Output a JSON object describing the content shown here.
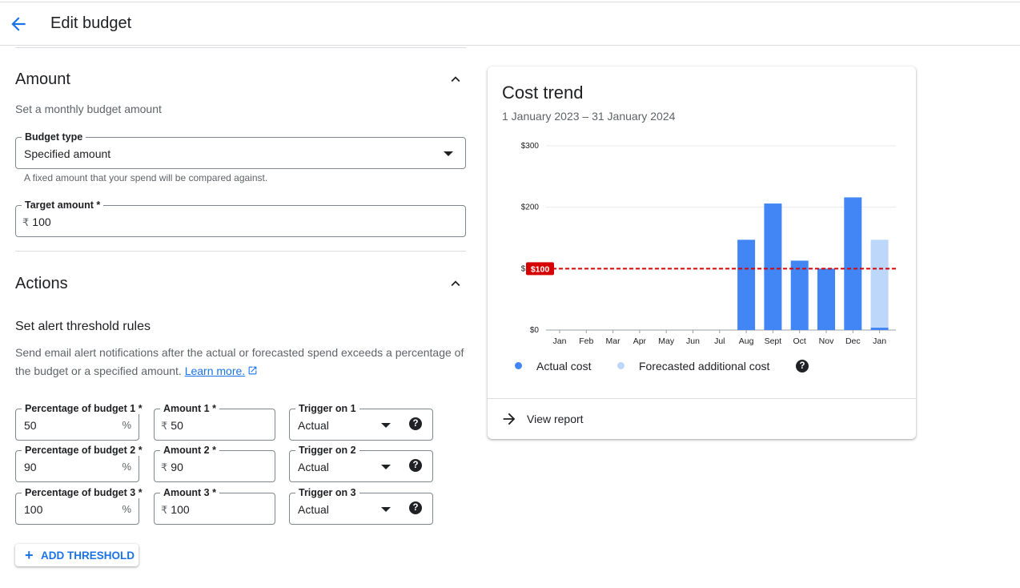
{
  "header": {
    "title": "Edit budget"
  },
  "amount": {
    "title": "Amount",
    "subtitle": "Set a monthly budget amount",
    "budget_type": {
      "label": "Budget type",
      "value": "Specified amount",
      "helper": "A fixed amount that your spend will be compared against."
    },
    "target_amount": {
      "label": "Target amount *",
      "currency": "₹",
      "value": "100"
    }
  },
  "actions": {
    "title": "Actions",
    "rules_title": "Set alert threshold rules",
    "description": "Send email alert notifications after the actual or forecasted spend exceeds a percentage of the budget or a specified amount.",
    "learn_more": "Learn more.",
    "thresholds": [
      {
        "percent_label": "Percentage of budget 1 *",
        "percent": "50",
        "percent_suffix": "%",
        "amount_label": "Amount 1 *",
        "currency": "₹",
        "amount": "50",
        "trigger_label": "Trigger on 1",
        "trigger": "Actual"
      },
      {
        "percent_label": "Percentage of budget 2 *",
        "percent": "90",
        "percent_suffix": "%",
        "amount_label": "Amount 2 *",
        "currency": "₹",
        "amount": "90",
        "trigger_label": "Trigger on 2",
        "trigger": "Actual"
      },
      {
        "percent_label": "Percentage of budget 3 *",
        "percent": "100",
        "percent_suffix": "%",
        "amount_label": "Amount 3 *",
        "currency": "₹",
        "amount": "100",
        "trigger_label": "Trigger on 3",
        "trigger": "Actual"
      }
    ],
    "add_threshold": "ADD THRESHOLD",
    "help_glyph": "?"
  },
  "cost_trend": {
    "title": "Cost trend",
    "date_range": "1 January 2023 – 31 January 2024",
    "legend": {
      "actual": "Actual cost",
      "forecast": "Forecasted additional cost"
    },
    "view_report": "View report"
  },
  "colors": {
    "actual": "#4285f4",
    "forecast": "#bdd7fb",
    "budget_line": "#d50000",
    "accent": "#1a73e8"
  },
  "chart_data": {
    "type": "bar",
    "categories": [
      "Jan",
      "Feb",
      "Mar",
      "Apr",
      "May",
      "Jun",
      "Jul",
      "Aug",
      "Sept",
      "Oct",
      "Nov",
      "Dec",
      "Jan"
    ],
    "series": [
      {
        "name": "Actual cost",
        "values": [
          0,
          0,
          0,
          0,
          0,
          0,
          0,
          147,
          206,
          113,
          100,
          216,
          4
        ]
      },
      {
        "name": "Forecasted additional cost",
        "values": [
          0,
          0,
          0,
          0,
          0,
          0,
          0,
          0,
          0,
          0,
          0,
          0,
          143
        ]
      }
    ],
    "stacked": true,
    "y_ticks": [
      "$0",
      "$100",
      "$200",
      "$300"
    ],
    "ylim": [
      0,
      300
    ],
    "budget_line": {
      "value": 100,
      "label": "$100"
    },
    "grid": true,
    "legend": "bottom"
  }
}
